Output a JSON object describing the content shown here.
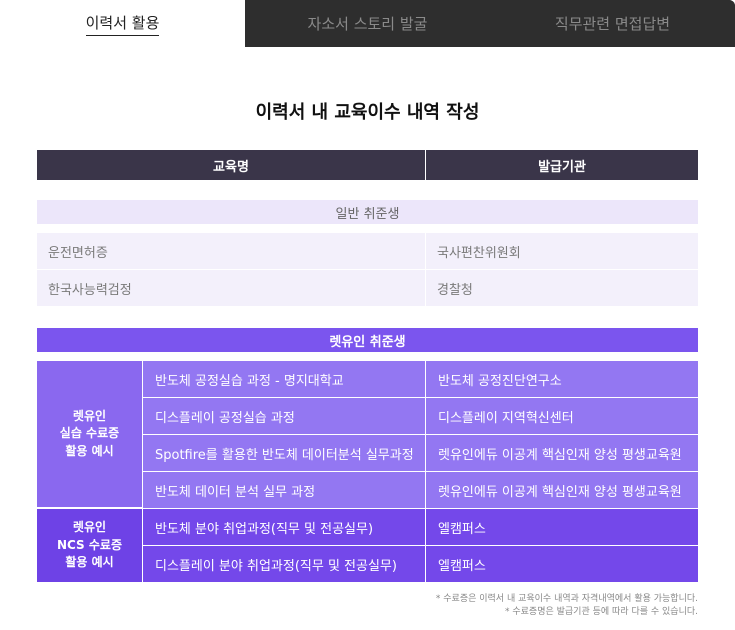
{
  "tabs": [
    {
      "label": "이력서 활용",
      "active": true
    },
    {
      "label": "자소서 스토리 발굴",
      "active": false
    },
    {
      "label": "직무관련 면접답변",
      "active": false
    }
  ],
  "title": "이력서 내 교육이수 내역 작성",
  "table_header": {
    "col1": "교육명",
    "col2": "발급기관"
  },
  "general": {
    "label": "일반 취준생",
    "rows": [
      [
        "운전면허증",
        "국사편찬위원회"
      ],
      [
        "한국사능력검정",
        "경찰청"
      ]
    ]
  },
  "letuin": {
    "label": "렛유인 취준생",
    "group_a": {
      "label": "렛유인\n실습 수료증\n활용 예시",
      "rows": [
        [
          "반도체 공정실습 과정 - 명지대학교",
          "반도체 공정진단연구소"
        ],
        [
          "디스플레이 공정실습 과정",
          "디스플레이 지역혁신센터"
        ],
        [
          "Spotfire를 활용한 반도체 데이터분석 실무과정",
          "렛유인에듀 이공계 핵심인재 양성 평생교육원"
        ],
        [
          "반도체 데이터 분석 실무 과정",
          "렛유인에듀 이공계 핵심인재 양성 평생교육원"
        ]
      ]
    },
    "group_b": {
      "label": "렛유인\nNCS 수료증\n활용 예시",
      "rows": [
        [
          "반도체 분야 취업과정(직무 및 전공실무)",
          "엘캠퍼스"
        ],
        [
          "디스플레이 분야 취업과정(직무 및 전공실무)",
          "엘캠퍼스"
        ]
      ]
    }
  },
  "notes": [
    "* 수료증은 이력서 내 교육이수 내역과 자격내역에서 활용 가능합니다.",
    "* 수료증명은 발급기관 등에 따라 다를 수 있습니다."
  ],
  "colors": {
    "header_bg": "#3a3549",
    "accent": "#7b55ee",
    "light_purple": "#ece6fa",
    "tab_dark": "#2e2e2e"
  }
}
